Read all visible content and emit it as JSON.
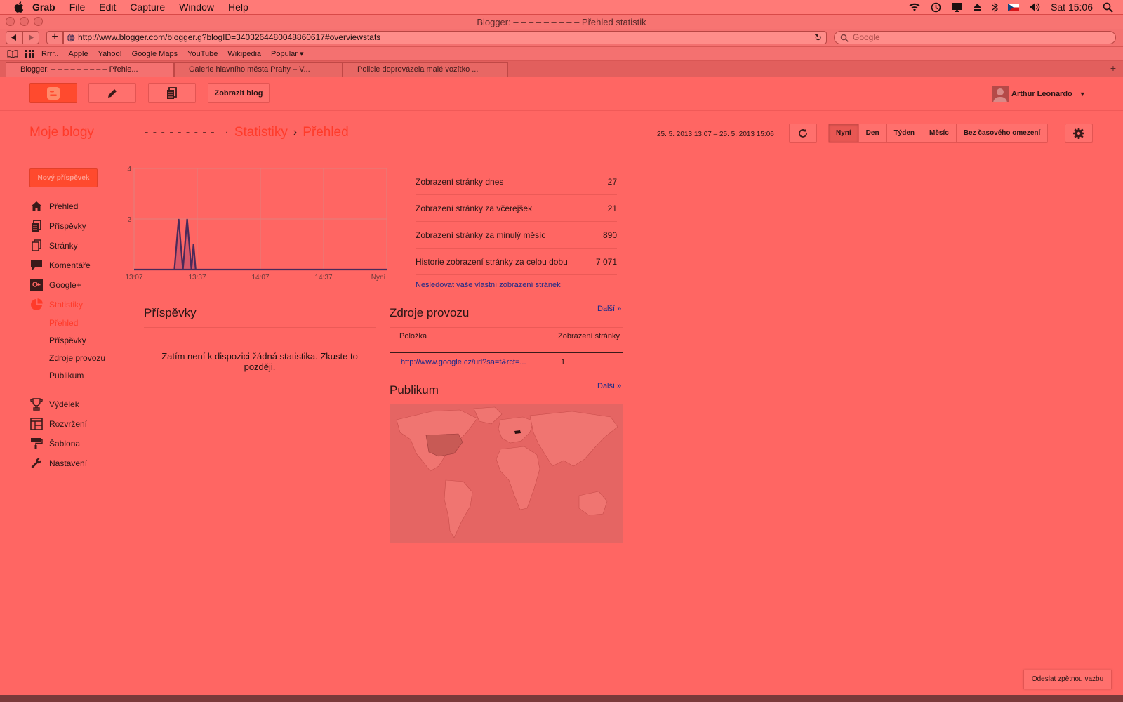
{
  "menubar": {
    "app": "Grab",
    "items": [
      "File",
      "Edit",
      "Capture",
      "Window",
      "Help"
    ],
    "clock": "Sat 15:06"
  },
  "window": {
    "title": "Blogger: – – – – – – – – – Přehled statistik"
  },
  "toolbar": {
    "url": "http://www.blogger.com/blogger.g?blogID=3403264480048860617#overviewstats",
    "search_placeholder": "Google"
  },
  "bookmarks": [
    "Rrrr..",
    "Apple",
    "Yahoo!",
    "Google Maps",
    "YouTube",
    "Wikipedia",
    "Popular ▾"
  ],
  "tabs": [
    {
      "label": "Blogger: – – – – – – – – – Přehle..."
    },
    {
      "label": "Galerie hlavního města Prahy – V..."
    },
    {
      "label": "Policie doprovázela malé vozítko ..."
    }
  ],
  "header": {
    "view_blog": "Zobrazit blog",
    "user": "Arthur Leonardo"
  },
  "subheader": {
    "my_blogs": "Moje blogy",
    "blog_name": "- - - - - - - - -",
    "crumb_stats": "Statistiky",
    "crumb_overview": "Přehled",
    "date_range": "25. 5. 2013 13:07 – 25. 5. 2013 15:06",
    "ranges": [
      "Nyní",
      "Den",
      "Týden",
      "Měsíc",
      "Bez časového omezení"
    ]
  },
  "sidebar": {
    "new_post": "Nový příspěvek",
    "items": [
      {
        "label": "Přehled",
        "icon": "home-icon"
      },
      {
        "label": "Příspěvky",
        "icon": "posts-icon"
      },
      {
        "label": "Stránky",
        "icon": "pages-icon"
      },
      {
        "label": "Komentáře",
        "icon": "comment-icon"
      },
      {
        "label": "Google+",
        "icon": "google-plus-icon"
      },
      {
        "label": "Statistiky",
        "icon": "pie-chart-icon"
      }
    ],
    "stats_sub": [
      "Přehled",
      "Příspěvky",
      "Zdroje provozu",
      "Publikum"
    ],
    "items2": [
      {
        "label": "Výdělek",
        "icon": "trophy-icon"
      },
      {
        "label": "Rozvržení",
        "icon": "layout-icon"
      },
      {
        "label": "Šablona",
        "icon": "paint-roller-icon"
      },
      {
        "label": "Nastavení",
        "icon": "wrench-icon"
      }
    ]
  },
  "chart_data": {
    "type": "area",
    "x_ticks": [
      "13:07",
      "13:37",
      "14:07",
      "14:37",
      "Nyní"
    ],
    "y_ticks": [
      2,
      4
    ],
    "ylim": [
      0,
      4
    ],
    "grid": true,
    "x": [
      0,
      19,
      20,
      21,
      22,
      23,
      24,
      25,
      26,
      27,
      28,
      29,
      30,
      31,
      32,
      33,
      34,
      35,
      36,
      37,
      38,
      39,
      40,
      41,
      42,
      43,
      44,
      45,
      46,
      47,
      48,
      49,
      50,
      51,
      52,
      53,
      54,
      55,
      56,
      57,
      58,
      59,
      60,
      61,
      62,
      63,
      64,
      65,
      66,
      67,
      68,
      69,
      70,
      71,
      72,
      73,
      74,
      75,
      76,
      77,
      78,
      79,
      80,
      81,
      82,
      83,
      84,
      85,
      86,
      87,
      88,
      89,
      90,
      91,
      92,
      93,
      94,
      95,
      96,
      97,
      98,
      99,
      100,
      101,
      102,
      103,
      104,
      105,
      106,
      107,
      108,
      109,
      110,
      111,
      112,
      113,
      114,
      115,
      116,
      117,
      118,
      119
    ],
    "values": [
      0,
      0,
      1,
      2,
      1,
      0,
      1,
      2,
      1,
      0,
      1,
      0,
      0,
      0,
      0,
      0,
      0,
      0,
      0,
      0,
      0,
      0,
      0,
      0,
      0,
      0,
      0,
      0,
      0,
      0,
      0,
      0,
      0,
      0,
      0,
      0,
      0,
      0,
      0,
      0,
      0,
      0,
      0,
      0,
      0,
      0,
      0,
      0,
      0,
      0,
      0,
      0,
      0,
      0,
      0,
      0,
      0,
      0,
      0,
      0,
      0,
      0,
      0,
      0,
      0,
      0,
      0,
      0,
      0,
      0,
      0,
      0,
      0,
      0,
      0,
      0,
      0,
      0,
      0,
      0,
      0,
      0,
      0,
      0,
      0,
      0,
      0,
      0,
      0,
      0,
      0,
      0,
      0,
      0,
      0,
      0,
      0,
      0,
      0,
      0,
      0,
      0
    ]
  },
  "stats": {
    "rows": [
      {
        "label": "Zobrazení stránky dnes",
        "value": "27"
      },
      {
        "label": "Zobrazení stránky za včerejšek",
        "value": "21"
      },
      {
        "label": "Zobrazení stránky za minulý měsíc",
        "value": "890"
      },
      {
        "label": "Historie zobrazení stránky za celou dobu",
        "value": "7 071"
      }
    ],
    "link": "Nesledovat vaše vlastní zobrazení stránek"
  },
  "posts": {
    "title": "Příspěvky",
    "empty": "Zatím není k dispozici žádná statistika. Zkuste to později."
  },
  "traffic": {
    "title": "Zdroje provozu",
    "more": "Další »",
    "col1": "Položka",
    "col2": "Zobrazení stránky",
    "rows": [
      {
        "url": "http://www.google.cz/url?sa=t&rct=...",
        "views": "1"
      }
    ]
  },
  "audience": {
    "title": "Publikum",
    "more": "Další »"
  },
  "feedback": "Odeslat zpětnou vazbu"
}
